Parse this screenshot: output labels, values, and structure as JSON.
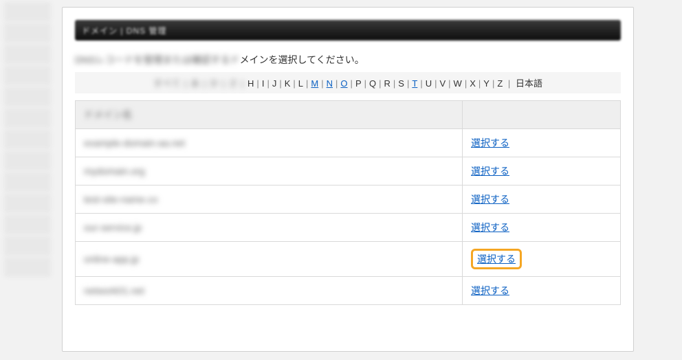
{
  "titlebar": {
    "text": "ドメイン | DNS 管理"
  },
  "instruction": {
    "lead": "DNSレコードを管理または確認するド",
    "tail": "メインを選択してください。"
  },
  "alphabar": {
    "lead": "すべて | あ | か | さ | ",
    "items": [
      {
        "t": "H",
        "link": false
      },
      {
        "t": "I",
        "link": false
      },
      {
        "t": "J",
        "link": false
      },
      {
        "t": "K",
        "link": false
      },
      {
        "t": "L",
        "link": false
      },
      {
        "t": "M",
        "link": true
      },
      {
        "t": "N",
        "link": true
      },
      {
        "t": "O",
        "link": true
      },
      {
        "t": "P",
        "link": false
      },
      {
        "t": "Q",
        "link": false
      },
      {
        "t": "R",
        "link": false
      },
      {
        "t": "S",
        "link": false
      },
      {
        "t": "T",
        "link": true
      },
      {
        "t": "U",
        "link": false
      },
      {
        "t": "V",
        "link": false
      },
      {
        "t": "W",
        "link": false
      },
      {
        "t": "X",
        "link": false
      },
      {
        "t": "Y",
        "link": false
      },
      {
        "t": "Z",
        "link": false
      }
    ],
    "trail": "日本語"
  },
  "table": {
    "header_domain": "ドメイン名",
    "header_action": "",
    "action_label": "選択する",
    "rows": [
      {
        "domain": "example-domain-aa.net",
        "highlight": false
      },
      {
        "domain": "mydomain.org",
        "highlight": false
      },
      {
        "domain": "test-site-name.co",
        "highlight": false
      },
      {
        "domain": "our-service.jp",
        "highlight": false
      },
      {
        "domain": "online-app.jp",
        "highlight": true
      },
      {
        "domain": "network01.net",
        "highlight": false
      }
    ]
  }
}
